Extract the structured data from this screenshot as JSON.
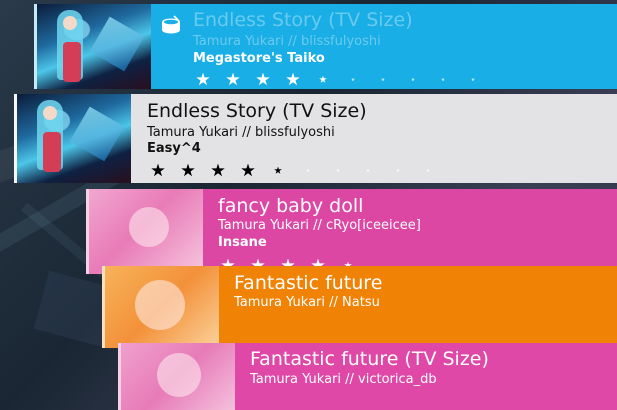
{
  "song_list": [
    {
      "title": "Endless Story (TV Size)",
      "artist_mapper": "Tamura Yukari // blissfulyoshi",
      "difficulty": "Megastore's Taiko",
      "mode_icon": "taiko-drum-icon",
      "star_rating": 4.3,
      "color": "#19aee6"
    },
    {
      "title": "Endless Story (TV Size)",
      "artist_mapper": "Tamura Yukari // blissfulyoshi",
      "difficulty": "Easy^4",
      "star_rating": 4.3,
      "color": "#e3e3e5"
    },
    {
      "title": "fancy baby doll",
      "artist_mapper": "Tamura Yukari // cRyo[iceeicee]",
      "difficulty": "Insane",
      "star_rating": 4.4,
      "color": "#dc47a4"
    },
    {
      "title": "Fantastic future",
      "artist_mapper": "Tamura Yukari // Natsu",
      "color": "#f08206"
    },
    {
      "title": "Fantastic future (TV Size)",
      "artist_mapper": "Tamura Yukari // victorica_db",
      "color": "#df48a7"
    }
  ]
}
